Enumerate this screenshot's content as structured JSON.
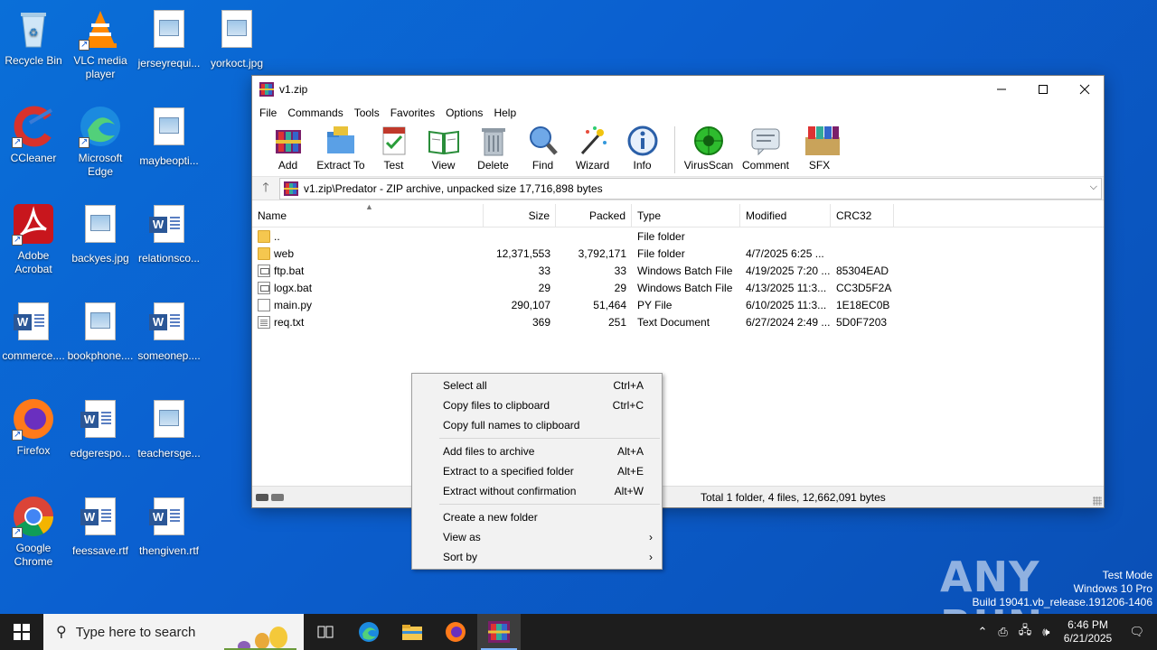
{
  "desktop": {
    "icons": [
      {
        "label": "Recycle Bin",
        "kind": "recycle-bin-icon"
      },
      {
        "label": "VLC media player",
        "kind": "vlc-icon"
      },
      {
        "label": "jerseyrequi...",
        "kind": "image-file-icon"
      },
      {
        "label": "yorkoct.jpg",
        "kind": "image-file-icon"
      },
      {
        "label": "CCleaner",
        "kind": "ccleaner-icon"
      },
      {
        "label": "Microsoft Edge",
        "kind": "edge-icon"
      },
      {
        "label": "maybeopti...",
        "kind": "image-file-icon"
      },
      {
        "label": "Adobe Acrobat",
        "kind": "acrobat-icon"
      },
      {
        "label": "backyes.jpg",
        "kind": "image-file-icon"
      },
      {
        "label": "relationsco...",
        "kind": "word-doc-icon"
      },
      {
        "label": "commerce....",
        "kind": "word-doc-icon"
      },
      {
        "label": "bookphone....",
        "kind": "image-file-icon"
      },
      {
        "label": "someonep....",
        "kind": "word-doc-icon"
      },
      {
        "label": "Firefox",
        "kind": "firefox-icon"
      },
      {
        "label": "edgerespo...",
        "kind": "word-doc-icon"
      },
      {
        "label": "teachersge...",
        "kind": "image-file-icon"
      },
      {
        "label": "Google Chrome",
        "kind": "chrome-icon"
      },
      {
        "label": "feessave.rtf",
        "kind": "word-doc-icon"
      },
      {
        "label": "thengiven.rtf",
        "kind": "word-doc-icon"
      }
    ]
  },
  "window": {
    "title": "v1.zip",
    "controls": {
      "minimize": "—",
      "maximize": "☐",
      "close": "✕"
    },
    "menu": [
      "File",
      "Commands",
      "Tools",
      "Favorites",
      "Options",
      "Help"
    ],
    "toolbar": [
      {
        "label": "Add",
        "icon": "add-archive-icon"
      },
      {
        "label": "Extract To",
        "icon": "extract-icon"
      },
      {
        "label": "Test",
        "icon": "test-icon"
      },
      {
        "label": "View",
        "icon": "view-icon"
      },
      {
        "label": "Delete",
        "icon": "delete-icon"
      },
      {
        "label": "Find",
        "icon": "find-icon"
      },
      {
        "label": "Wizard",
        "icon": "wizard-icon"
      },
      {
        "label": "Info",
        "icon": "info-icon"
      },
      {
        "label": "VirusScan",
        "icon": "virus-scan-icon"
      },
      {
        "label": "Comment",
        "icon": "comment-icon"
      },
      {
        "label": "SFX",
        "icon": "sfx-icon"
      }
    ],
    "address": "v1.zip\\Predator - ZIP archive, unpacked size 17,716,898 bytes",
    "columns": {
      "name": "Name",
      "size": "Size",
      "packed": "Packed",
      "type": "Type",
      "modified": "Modified",
      "crc": "CRC32"
    },
    "files": [
      {
        "name": "..",
        "size": "",
        "packed": "",
        "type": "File folder",
        "modified": "",
        "crc": "",
        "icon": "folder"
      },
      {
        "name": "web",
        "size": "12,371,553",
        "packed": "3,792,171",
        "type": "File folder",
        "modified": "4/7/2025 6:25 ...",
        "crc": "",
        "icon": "folder"
      },
      {
        "name": "ftp.bat",
        "size": "33",
        "packed": "33",
        "type": "Windows Batch File",
        "modified": "4/19/2025 7:20 ...",
        "crc": "85304EAD",
        "icon": "bat"
      },
      {
        "name": "logx.bat",
        "size": "29",
        "packed": "29",
        "type": "Windows Batch File",
        "modified": "4/13/2025 11:3...",
        "crc": "CC3D5F2A",
        "icon": "bat"
      },
      {
        "name": "main.py",
        "size": "290,107",
        "packed": "51,464",
        "type": "PY File",
        "modified": "6/10/2025 11:3...",
        "crc": "1E18EC0B",
        "icon": "py"
      },
      {
        "name": "req.txt",
        "size": "369",
        "packed": "251",
        "type": "Text Document",
        "modified": "6/27/2024 2:49 ...",
        "crc": "5D0F7203",
        "icon": "txt"
      }
    ],
    "status": "Total 1 folder, 4 files, 12,662,091 bytes"
  },
  "context_menu": {
    "groups": [
      [
        {
          "label": "Select all",
          "accel": "Ctrl+A"
        },
        {
          "label": "Copy files to clipboard",
          "accel": "Ctrl+C"
        },
        {
          "label": "Copy full names to clipboard",
          "accel": ""
        }
      ],
      [
        {
          "label": "Add files to archive",
          "accel": "Alt+A"
        },
        {
          "label": "Extract to a specified folder",
          "accel": "Alt+E"
        },
        {
          "label": "Extract without confirmation",
          "accel": "Alt+W"
        }
      ],
      [
        {
          "label": "Create a new folder",
          "accel": "",
          "submenu": false
        },
        {
          "label": "View as",
          "accel": "",
          "submenu": true
        },
        {
          "label": "Sort by",
          "accel": "",
          "submenu": true
        }
      ]
    ],
    "submenu_arrow": "›"
  },
  "taskbar": {
    "search_placeholder": "Type here to search",
    "time": "6:46 PM",
    "date": "6/21/2025",
    "apps": [
      "task-view-icon",
      "edge-icon",
      "file-explorer-icon",
      "firefox-icon",
      "winrar-icon"
    ]
  },
  "watermark": {
    "brand": "ANY RUN",
    "line1": "Test Mode",
    "line2": "Windows 10 Pro",
    "line3": "Build 19041.vb_release.191206-1406"
  },
  "colors": {
    "desktop": "#0b5fcf",
    "taskbar": "#1d1d1d",
    "folder": "#f5c74f"
  }
}
